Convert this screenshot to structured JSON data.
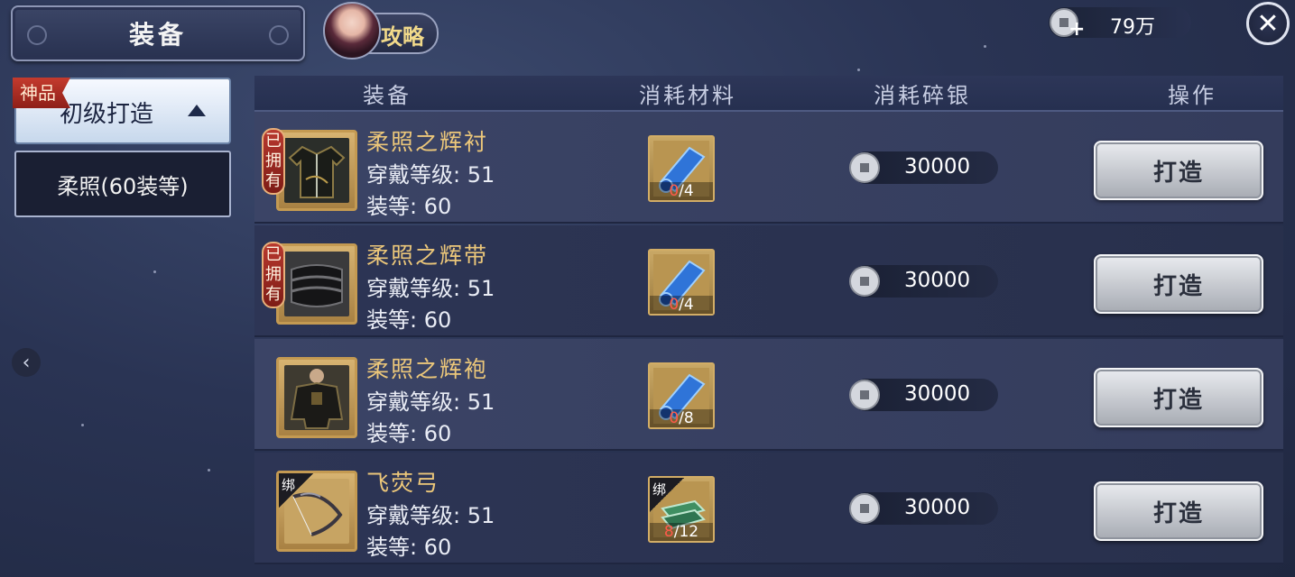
{
  "header": {
    "title": "装备",
    "guide_label": "攻略",
    "currency": {
      "amount": "79万",
      "plus": "+"
    },
    "close_glyph": "✕"
  },
  "sidebar": {
    "rank_badge": "神品",
    "tier_tab": "初级打造",
    "sub_tab": "柔照(60装等)",
    "collapse_glyph": "‹"
  },
  "table": {
    "columns": [
      "装备",
      "消耗材料",
      "消耗碎银",
      "操作"
    ],
    "rows": [
      {
        "name": "柔照之辉衬",
        "req": "穿戴等级: 51",
        "gs": "装等: 60",
        "owned": "已拥有",
        "bound": "",
        "mat_have": "0",
        "mat_need": "/4",
        "mat_type": "cloth-scroll-icon",
        "cost": "30000",
        "action": "打造"
      },
      {
        "name": "柔照之辉带",
        "req": "穿戴等级: 51",
        "gs": "装等: 60",
        "owned": "已拥有",
        "bound": "",
        "mat_have": "0",
        "mat_need": "/4",
        "mat_type": "cloth-scroll-icon",
        "cost": "30000",
        "action": "打造"
      },
      {
        "name": "柔照之辉袍",
        "req": "穿戴等级: 51",
        "gs": "装等: 60",
        "owned": "",
        "bound": "",
        "mat_have": "0",
        "mat_need": "/8",
        "mat_type": "cloth-scroll-icon",
        "cost": "30000",
        "action": "打造"
      },
      {
        "name": "飞荧弓",
        "req": "穿戴等级: 51",
        "gs": "装等: 60",
        "owned": "",
        "bound": "绑",
        "mat_have": "8",
        "mat_need": "/12",
        "mat_type": "jade-ingot-icon",
        "mat_bound": "绑",
        "cost": "30000",
        "action": "打造"
      }
    ]
  },
  "colors": {
    "item_name": "#ecc77a",
    "owned_tag": "#b8392f",
    "insufficient": "#ff5a4a"
  }
}
